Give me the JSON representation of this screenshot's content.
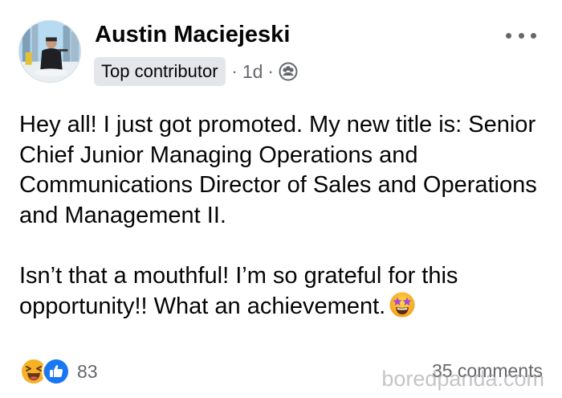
{
  "post": {
    "author": "Austin Maciejeski",
    "badge": "Top contributor",
    "separator": "·",
    "time": "1d",
    "audience_icon": "friends-icon",
    "more_icon": "more-options-icon",
    "paragraph_1": "Hey all! I just got promoted. My new title is: Senior Chief Junior Managing Operations and Communications Director of Sales and Operations and Management II.",
    "paragraph_2": "Isn’t that a mouthful! I’m so grateful for this opportunity!! What an achievement.",
    "paragraph_2_emoji": "star-struck-emoji"
  },
  "footer": {
    "reaction_icons": [
      "laughing-reaction-icon",
      "like-reaction-icon"
    ],
    "reaction_count": "83",
    "comments": "35 comments"
  },
  "watermark": {
    "text": "boredpanda.com"
  },
  "colors": {
    "text": "#050505",
    "secondary_text": "#65676b",
    "badge_bg": "#e4e6eb",
    "like_blue": "#1877f2",
    "haha_yellow": "#f7b125"
  }
}
